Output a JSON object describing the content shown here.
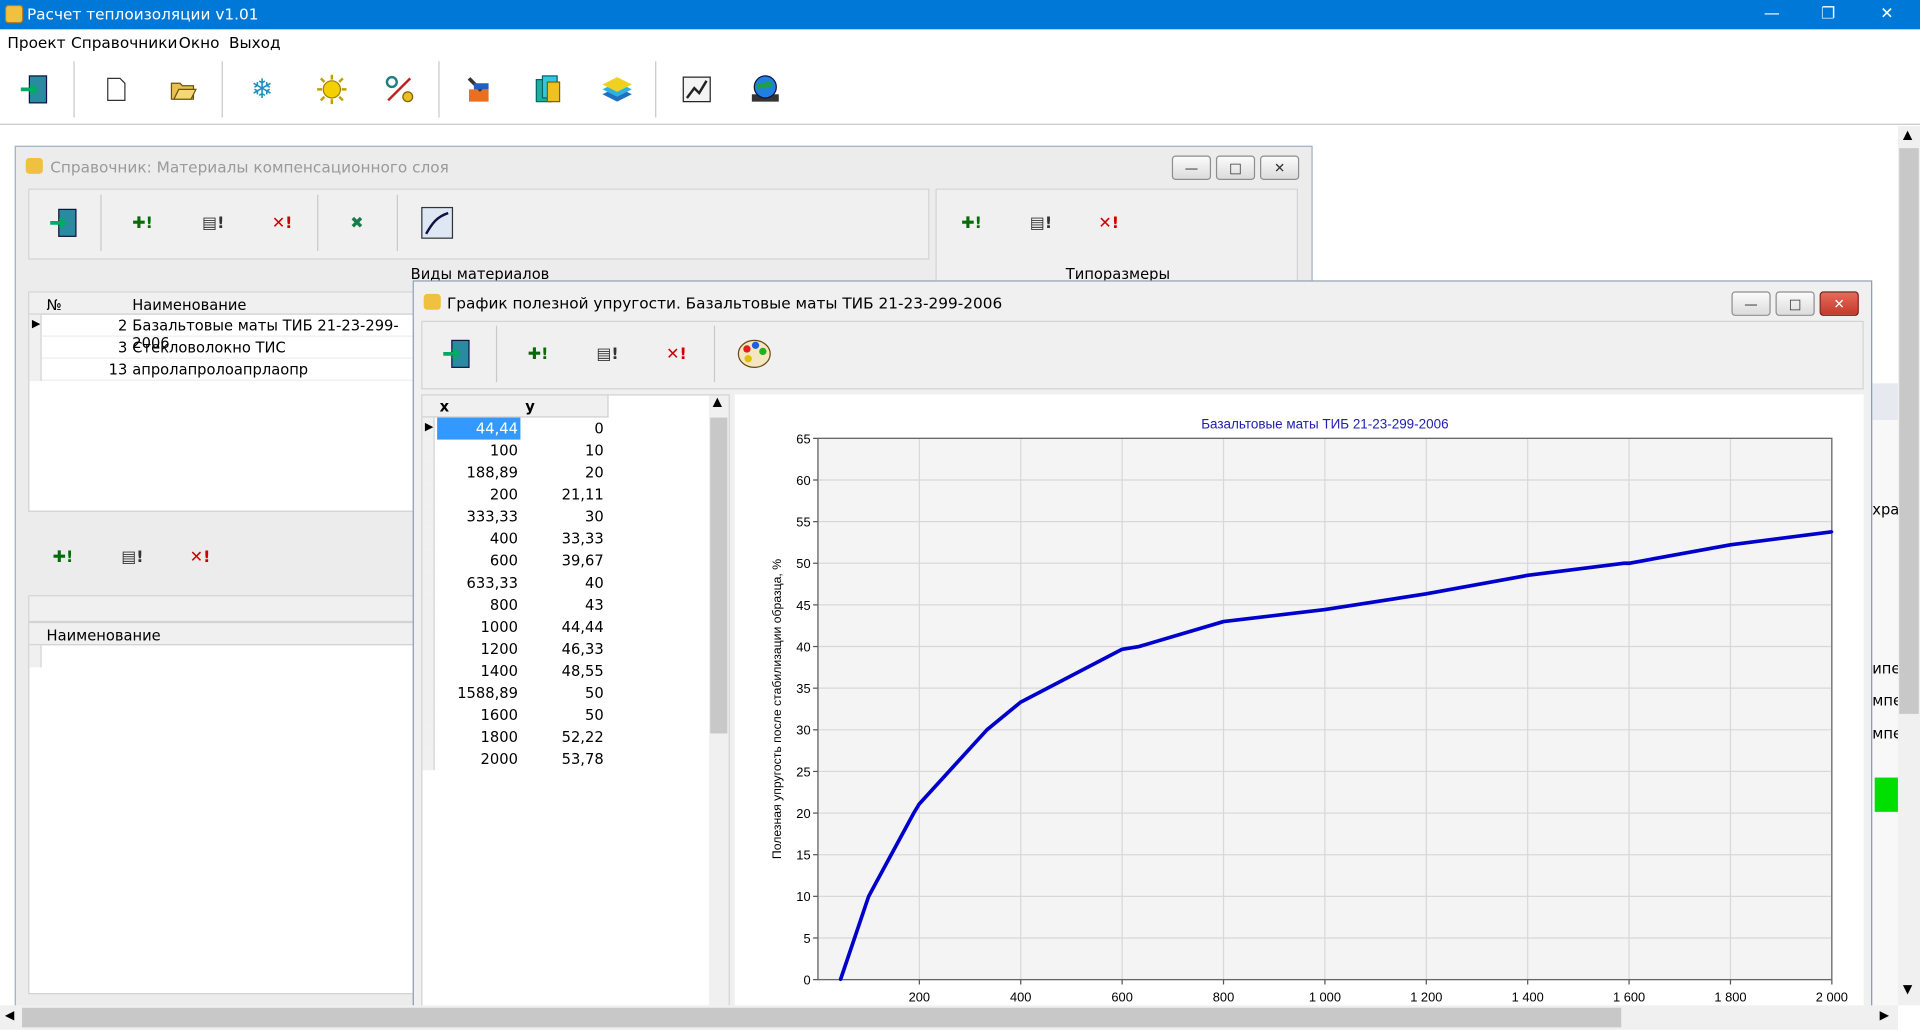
{
  "app": {
    "title": "Расчет теплоизоляции v1.01"
  },
  "menu": [
    "Проект",
    "Справочники",
    "Окно",
    "Выход"
  ],
  "toolbar_icons": [
    "exit-door-icon",
    "new-document-icon",
    "open-folder-icon",
    "snowflake-icon",
    "sun-icon",
    "percent-icon",
    "tools-icon",
    "layers-icon",
    "stack-icon",
    "chart-report-icon",
    "globe-icon"
  ],
  "ref_window": {
    "title": "Справочник: Материалы компенсационного слоя",
    "section_left": "Виды материалов",
    "section_right": "Типоразмеры",
    "col_num": "№",
    "col_name": "Наименование",
    "rows": [
      {
        "num": "2",
        "name": "Базальтовые маты ТИБ 21-23-299-2006"
      },
      {
        "num": "3",
        "name": "Стекловолокно ТИС"
      },
      {
        "num": "13",
        "name": "апролапролоапрлаопр"
      }
    ],
    "lower_col_name": "Наименование"
  },
  "graph_window": {
    "title": "График полезной упругости. Базальтовые маты ТИБ 21-23-299-2006",
    "col_x": "x",
    "col_y": "y",
    "table": [
      [
        "44,44",
        "0"
      ],
      [
        "100",
        "10"
      ],
      [
        "188,89",
        "20"
      ],
      [
        "200",
        "21,11"
      ],
      [
        "333,33",
        "30"
      ],
      [
        "400",
        "33,33"
      ],
      [
        "600",
        "39,67"
      ],
      [
        "633,33",
        "40"
      ],
      [
        "800",
        "43"
      ],
      [
        "1000",
        "44,44"
      ],
      [
        "1200",
        "46,33"
      ],
      [
        "1400",
        "48,55"
      ],
      [
        "1588,89",
        "50"
      ],
      [
        "1600",
        "50"
      ],
      [
        "1800",
        "52,22"
      ],
      [
        "2000",
        "53,78"
      ]
    ]
  },
  "bg_fragments": [
    "храї",
    "ипер",
    "мпе",
    "мпе"
  ],
  "colors": {
    "titlebar": "#0078d7",
    "series": "#0000cc",
    "selection": "#3399ff",
    "green": "#00e000"
  },
  "chart_data": {
    "type": "line",
    "title": "Базальтовые маты ТИБ 21-23-299-2006",
    "xlabel": "",
    "ylabel": "Полезная упругость после стабилизации образца, %",
    "xlim": [
      0,
      2000
    ],
    "ylim": [
      0,
      65
    ],
    "x_ticks": [
      "200",
      "400",
      "600",
      "800",
      "1 000",
      "1 200",
      "1 400",
      "1 600",
      "1 800",
      "2 000"
    ],
    "y_ticks": [
      "0",
      "5",
      "10",
      "15",
      "20",
      "25",
      "30",
      "35",
      "40",
      "45",
      "50",
      "55",
      "60",
      "65"
    ],
    "grid": true,
    "series": [
      {
        "x": [
          44.44,
          100,
          188.89,
          200,
          333.33,
          400,
          600,
          633.33,
          800,
          1000,
          1200,
          1400,
          1588.89,
          1600,
          1800,
          2000
        ],
        "y": [
          0,
          10,
          20,
          21.11,
          30,
          33.33,
          39.67,
          40,
          43,
          44.44,
          46.33,
          48.55,
          50,
          50,
          52.22,
          53.78
        ],
        "color": "#0000cc"
      }
    ]
  }
}
